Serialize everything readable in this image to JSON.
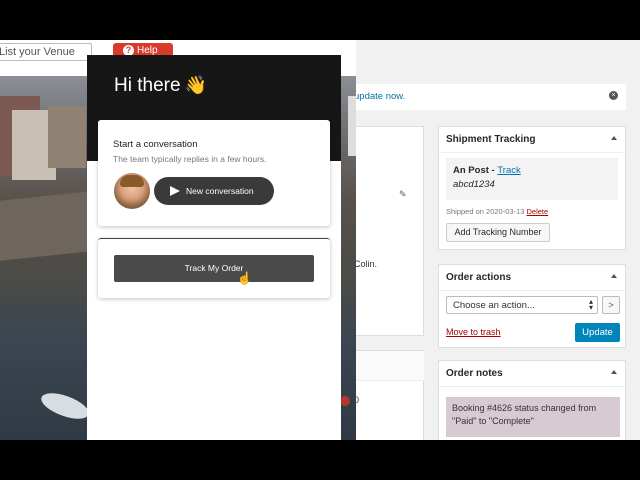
{
  "site": {
    "venue_placeholder": "List your Venue",
    "help_label": "Help"
  },
  "admin": {
    "notice_text": "update now.",
    "colin_text": "Colin.",
    "mid_text": "0",
    "shipment": {
      "title": "Shipment Tracking",
      "provider": "An Post",
      "track_link": "Track",
      "tracking_number": "abcd1234",
      "shipped_text": "Shipped on 2020-03-13",
      "delete_link": "Delete",
      "add_button": "Add Tracking Number"
    },
    "order_actions": {
      "title": "Order actions",
      "select_value": "Choose an action...",
      "go_label": ">",
      "trash_link": "Move to trash",
      "update_label": "Update"
    },
    "order_notes": {
      "title": "Order notes",
      "note": "Booking #4626 status changed from \"Paid\" to \"Complete\""
    }
  },
  "chat": {
    "greeting": "Hi there",
    "greeting_emoji": "👋",
    "card_title": "Start a conversation",
    "card_subtitle": "The team typically replies in a few hours.",
    "new_conversation": "New conversation",
    "track_order": "Track My Order"
  },
  "colors": {
    "help_red": "#d93b2b",
    "wp_blue": "#0085ba",
    "chat_dark": "#161616"
  }
}
